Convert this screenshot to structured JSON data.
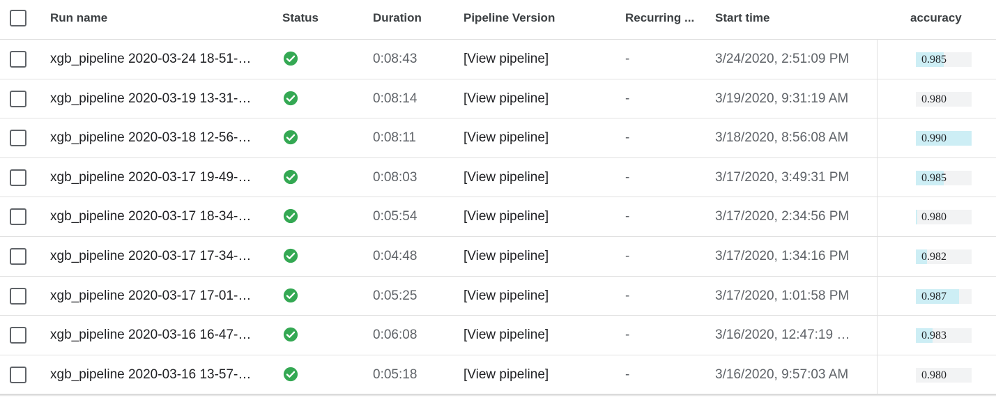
{
  "header": {
    "run_name": "Run name",
    "status": "Status",
    "duration": "Duration",
    "pipeline_version": "Pipeline Version",
    "recurring": "Recurring ...",
    "start_time": "Start time",
    "accuracy": "accuracy"
  },
  "status_icon": "check-circle-icon",
  "colors": {
    "success": "#34a853",
    "accuracy_fill": "#cdeef5",
    "accuracy_track": "#f2f3f4"
  },
  "rows": [
    {
      "name": "xgb_pipeline 2020-03-24 18-51-…",
      "duration": "0:08:43",
      "pipeline": "[View pipeline]",
      "recurring": "-",
      "start": "3/24/2020, 2:51:09 PM",
      "accuracy": "0.985",
      "accuracy_fill": 0.5
    },
    {
      "name": "xgb_pipeline 2020-03-19 13-31-…",
      "duration": "0:08:14",
      "pipeline": "[View pipeline]",
      "recurring": "-",
      "start": "3/19/2020, 9:31:19 AM",
      "accuracy": "0.980",
      "accuracy_fill": 0.0
    },
    {
      "name": "xgb_pipeline 2020-03-18 12-56-…",
      "duration": "0:08:11",
      "pipeline": "[View pipeline]",
      "recurring": "-",
      "start": "3/18/2020, 8:56:08 AM",
      "accuracy": "0.990",
      "accuracy_fill": 1.0
    },
    {
      "name": "xgb_pipeline 2020-03-17 19-49-…",
      "duration": "0:08:03",
      "pipeline": "[View pipeline]",
      "recurring": "-",
      "start": "3/17/2020, 3:49:31 PM",
      "accuracy": "0.985",
      "accuracy_fill": 0.5
    },
    {
      "name": "xgb_pipeline 2020-03-17 18-34-…",
      "duration": "0:05:54",
      "pipeline": "[View pipeline]",
      "recurring": "-",
      "start": "3/17/2020, 2:34:56 PM",
      "accuracy": "0.980",
      "accuracy_fill": 0.03
    },
    {
      "name": "xgb_pipeline 2020-03-17 17-34-…",
      "duration": "0:04:48",
      "pipeline": "[View pipeline]",
      "recurring": "-",
      "start": "3/17/2020, 1:34:16 PM",
      "accuracy": "0.982",
      "accuracy_fill": 0.2
    },
    {
      "name": "xgb_pipeline 2020-03-17 17-01-…",
      "duration": "0:05:25",
      "pipeline": "[View pipeline]",
      "recurring": "-",
      "start": "3/17/2020, 1:01:58 PM",
      "accuracy": "0.987",
      "accuracy_fill": 0.77
    },
    {
      "name": "xgb_pipeline 2020-03-16 16-47-…",
      "duration": "0:06:08",
      "pipeline": "[View pipeline]",
      "recurring": "-",
      "start": "3/16/2020, 12:47:19 …",
      "accuracy": "0.983",
      "accuracy_fill": 0.3
    },
    {
      "name": "xgb_pipeline 2020-03-16 13-57-…",
      "duration": "0:05:18",
      "pipeline": "[View pipeline]",
      "recurring": "-",
      "start": "3/16/2020, 9:57:03 AM",
      "accuracy": "0.980",
      "accuracy_fill": 0.0
    }
  ]
}
